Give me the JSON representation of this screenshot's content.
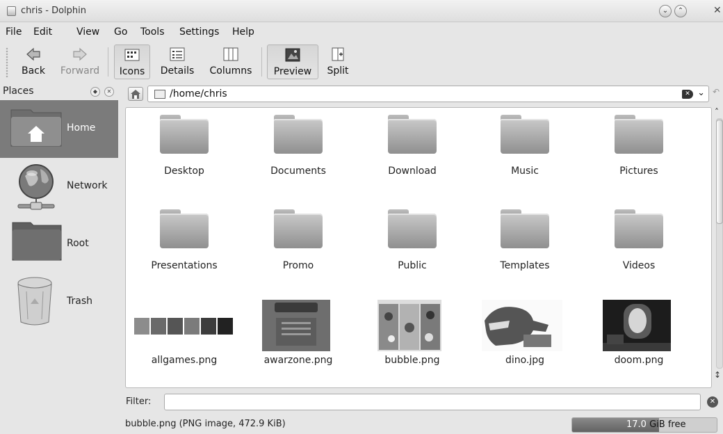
{
  "window": {
    "title": "chris - Dolphin"
  },
  "menu": [
    "File",
    "Edit",
    "View",
    "Go",
    "Tools",
    "Settings",
    "Help"
  ],
  "toolbar": {
    "back": "Back",
    "forward": "Forward",
    "icons": "Icons",
    "details": "Details",
    "columns": "Columns",
    "preview": "Preview",
    "split": "Split",
    "active_view": "Icons",
    "preview_on": true
  },
  "places": {
    "title": "Places",
    "items": [
      {
        "label": "Home",
        "icon": "home-folder-icon",
        "selected": true
      },
      {
        "label": "Network",
        "icon": "network-globe-icon"
      },
      {
        "label": "Root",
        "icon": "folder-icon"
      },
      {
        "label": "Trash",
        "icon": "trash-icon"
      }
    ]
  },
  "location": {
    "path": "/home/chris"
  },
  "files": [
    {
      "name": "Desktop",
      "kind": "folder"
    },
    {
      "name": "Documents",
      "kind": "folder"
    },
    {
      "name": "Download",
      "kind": "folder"
    },
    {
      "name": "Music",
      "kind": "folder"
    },
    {
      "name": "Pictures",
      "kind": "folder"
    },
    {
      "name": "Presentations",
      "kind": "folder"
    },
    {
      "name": "Promo",
      "kind": "folder"
    },
    {
      "name": "Public",
      "kind": "folder"
    },
    {
      "name": "Templates",
      "kind": "folder"
    },
    {
      "name": "Videos",
      "kind": "folder"
    },
    {
      "name": "allgames.png",
      "kind": "image"
    },
    {
      "name": "awarzone.png",
      "kind": "image"
    },
    {
      "name": "bubble.png",
      "kind": "image"
    },
    {
      "name": "dino.jpg",
      "kind": "image"
    },
    {
      "name": "doom.png",
      "kind": "image"
    }
  ],
  "filter": {
    "label": "Filter:",
    "value": ""
  },
  "status": {
    "text": "bubble.png (PNG image, 472.9 KiB)",
    "free_amount": "17.0",
    "free_suffix": " GiB free",
    "used_fraction": 0.6
  }
}
